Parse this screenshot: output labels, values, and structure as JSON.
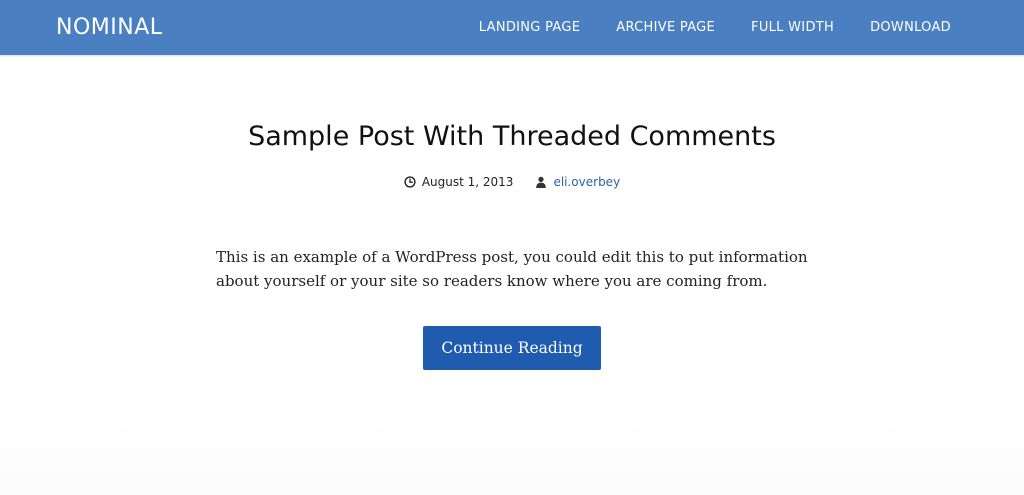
{
  "site": {
    "title": "NOMINAL"
  },
  "nav": {
    "items": [
      {
        "label": "LANDING PAGE"
      },
      {
        "label": "ARCHIVE PAGE"
      },
      {
        "label": "FULL WIDTH"
      },
      {
        "label": "DOWNLOAD"
      }
    ]
  },
  "post": {
    "title": "Sample Post With Threaded Comments",
    "date": "August 1, 2013",
    "date_icon": "clock-icon",
    "author": "eli.overbey",
    "author_icon": "user-icon",
    "excerpt": "This is an example of a WordPress post, you could edit this to put information about yourself or your site so readers know where you are coming from.",
    "continue_label": "Continue Reading"
  },
  "colors": {
    "header_bg": "#4a7fc1",
    "button_bg": "#1f5baf",
    "link": "#2a62ad"
  }
}
